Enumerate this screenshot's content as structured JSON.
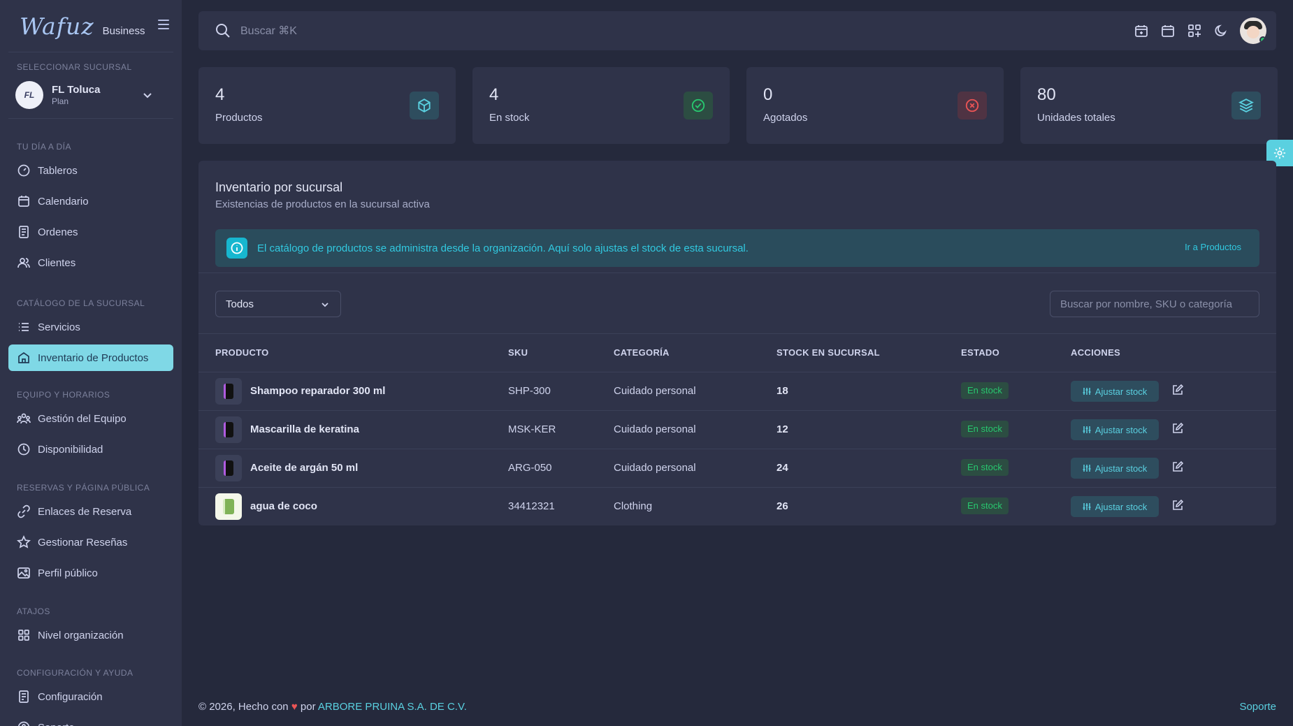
{
  "brand": {
    "logo": "Wafuz",
    "suffix": "Business"
  },
  "sidebar": {
    "branch_section": "SELECCIONAR SUCURSAL",
    "branch": {
      "initials": "FL",
      "name": "FL Toluca",
      "plan": "Plan"
    },
    "sections": [
      {
        "title": "TU DÍA A DÍA",
        "items": [
          {
            "label": "Tableros",
            "icon": "dashboard-icon"
          },
          {
            "label": "Calendario",
            "icon": "calendar-icon"
          },
          {
            "label": "Ordenes",
            "icon": "receipt-icon"
          },
          {
            "label": "Clientes",
            "icon": "users-icon"
          }
        ]
      },
      {
        "title": "CATÁLOGO DE LA SUCURSAL",
        "items": [
          {
            "label": "Servicios",
            "icon": "list-icon"
          },
          {
            "label": "Inventario de Productos",
            "icon": "building-icon",
            "active": true
          }
        ]
      },
      {
        "title": "EQUIPO Y HORARIOS",
        "items": [
          {
            "label": "Gestión del Equipo",
            "icon": "team-icon"
          },
          {
            "label": "Disponibilidad",
            "icon": "clock-icon"
          }
        ]
      },
      {
        "title": "RESERVAS Y PÁGINA PÚBLICA",
        "items": [
          {
            "label": "Enlaces de Reserva",
            "icon": "link-icon"
          },
          {
            "label": "Gestionar Reseñas",
            "icon": "star-icon"
          },
          {
            "label": "Perfil público",
            "icon": "image-icon"
          }
        ]
      },
      {
        "title": "ATAJOS",
        "items": [
          {
            "label": "Nivel organización",
            "icon": "grid-icon"
          }
        ]
      },
      {
        "title": "CONFIGURACIÓN Y AYUDA",
        "items": [
          {
            "label": "Configuración",
            "icon": "settings-icon"
          },
          {
            "label": "Soporte",
            "icon": "help-icon"
          }
        ]
      }
    ]
  },
  "topbar": {
    "search_placeholder": "Buscar ⌘K"
  },
  "stats": [
    {
      "value": "4",
      "label": "Productos",
      "icon": "cube-icon",
      "color": "#5ad0e0",
      "bg": "#2e4d5e"
    },
    {
      "value": "4",
      "label": "En stock",
      "icon": "check-circle-icon",
      "color": "#28c76f",
      "bg": "#2c4d42"
    },
    {
      "value": "0",
      "label": "Agotados",
      "icon": "x-circle-icon",
      "color": "#ea5455",
      "bg": "#4f3343"
    },
    {
      "value": "80",
      "label": "Unidades totales",
      "icon": "layers-icon",
      "color": "#5ad0e0",
      "bg": "#2e4d5e"
    }
  ],
  "inventory": {
    "title": "Inventario por sucursal",
    "subtitle": "Existencias de productos en la sucursal activa",
    "alert_text": "El catálogo de productos se administra desde la organización. Aquí solo ajustas el stock de esta sucursal.",
    "alert_link": "Ir a Productos",
    "filter_value": "Todos",
    "search_placeholder": "Buscar por nombre, SKU o categoría",
    "columns": [
      "PRODUCTO",
      "SKU",
      "CATEGORÍA",
      "STOCK EN SUCURSAL",
      "ESTADO",
      "ACCIONES"
    ],
    "rows": [
      {
        "name": "Shampoo reparador 300 ml",
        "sku": "SHP-300",
        "category": "Cuidado personal",
        "stock": "18",
        "status": "En stock",
        "action": "Ajustar stock"
      },
      {
        "name": "Mascarilla de keratina",
        "sku": "MSK-KER",
        "category": "Cuidado personal",
        "stock": "12",
        "status": "En stock",
        "action": "Ajustar stock"
      },
      {
        "name": "Aceite de argán 50 ml",
        "sku": "ARG-050",
        "category": "Cuidado personal",
        "stock": "24",
        "status": "En stock",
        "action": "Ajustar stock"
      },
      {
        "name": "agua de coco",
        "sku": "34412321",
        "category": "Clothing",
        "stock": "26",
        "status": "En stock",
        "action": "Ajustar stock"
      }
    ]
  },
  "footer": {
    "prefix": "© 2026, Hecho con",
    "by": "por",
    "company": "ARBORE PRUINA S.A. DE C.V.",
    "support": "Soporte"
  }
}
